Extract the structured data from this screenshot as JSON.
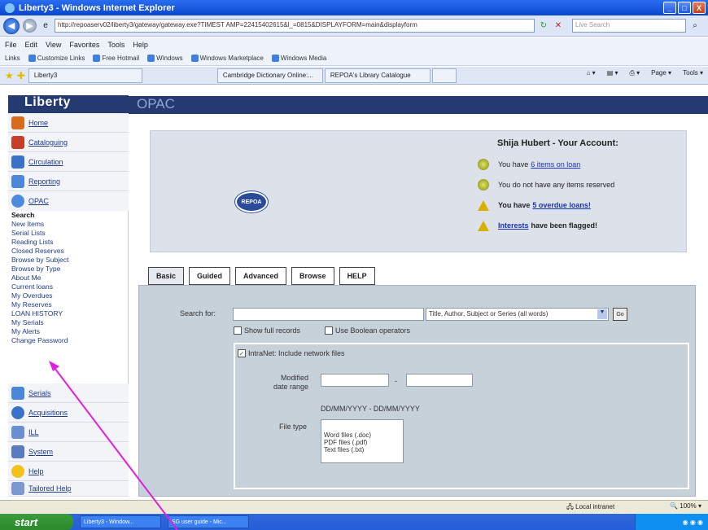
{
  "window": {
    "title": "Liberty3 - Windows Internet Explorer",
    "minimize": "_",
    "maximize": "□",
    "close": "X"
  },
  "address_bar": {
    "url": "http://repoaserv02/liberty3/gateway/gateway.exe?TIMEST AMP=22415402615&l_=0815&DISPLAYFORM=main&displayform",
    "search_placeholder": "Live Search"
  },
  "menu": [
    "File",
    "Edit",
    "View",
    "Favorites",
    "Tools",
    "Help"
  ],
  "links_bar": {
    "label": "Links",
    "items": [
      "Customize Links",
      "Free Hotmail",
      "Windows",
      "Windows Marketplace",
      "Windows Media"
    ]
  },
  "tabs": [
    {
      "label": "Liberty3"
    },
    {
      "label": "Cambridge Dictionary Online:..."
    },
    {
      "label": "REPOA's Library Catalogue"
    }
  ],
  "toolbar_tools": [
    "Page",
    "Tools"
  ],
  "sidebar": {
    "logo": "Liberty",
    "items": [
      {
        "label": "Home",
        "color": "#d86c1e"
      },
      {
        "label": "Cataloguing",
        "color": "#c43f2a"
      },
      {
        "label": "Circulation",
        "color": "#3a72c9"
      },
      {
        "label": "Reporting",
        "color": "#4a87d6"
      },
      {
        "label": "OPAC",
        "color": "#4d8be0"
      }
    ],
    "opac_sub": [
      "Search",
      "New Items",
      "Serial Lists",
      "Reading Lists",
      "Closed Reserves",
      "Browse by Subject",
      "Browse by Type",
      "About Me",
      "Current loans",
      "My Overdues",
      "My Reserves",
      "LOAN HISTORY",
      "My Serials",
      "My Alerts",
      "Change Password"
    ],
    "lower_items": [
      {
        "label": "Serials",
        "color": "#4a87d6"
      },
      {
        "label": "Acquisitions",
        "color": "#3a72c9"
      },
      {
        "label": "ILL",
        "color": "#6a8fd0"
      },
      {
        "label": "System",
        "color": "#5a7bbd"
      },
      {
        "label": "Help",
        "color": "#f2c21a"
      },
      {
        "label": "Tailored Help",
        "color": "#7b99cf"
      }
    ]
  },
  "main": {
    "header": "OPAC",
    "logo_text": "REPOA",
    "account": {
      "title": "Shija Hubert - Your Account:",
      "line1_pre": "You have",
      "line1_link": "6 items on loan",
      "line2": "You do not have any items reserved",
      "line3_pre": "You have",
      "line3_link": "5 overdue loans!",
      "line4_link": "Interests",
      "line4_post": "have been flagged!"
    },
    "search_tabs": [
      "Basic",
      "Guided",
      "Advanced",
      "Browse",
      "HELP"
    ],
    "search": {
      "label": "Search for:",
      "select_value": "Title, Author, Subject or Series (all words)",
      "go": "Go",
      "show_full": "Show full records",
      "use_boolean": "Use Boolean operators",
      "intranet": "IntraNet: Include network files",
      "modified_label": "Modified date range",
      "dash": "-",
      "date_format": "DD/MM/YYYY - DD/MM/YYYY",
      "file_type_label": "File type",
      "file_types": [
        "Word files (.doc)",
        "PDF files (.pdf)",
        "Text files (.txt)"
      ]
    }
  },
  "status": {
    "zone": "Local intranet",
    "zoom": "100%"
  },
  "taskbar": {
    "start": "start",
    "tasks": [
      "Liberty3 - Window...",
      "SG user guide - Mic..."
    ]
  }
}
